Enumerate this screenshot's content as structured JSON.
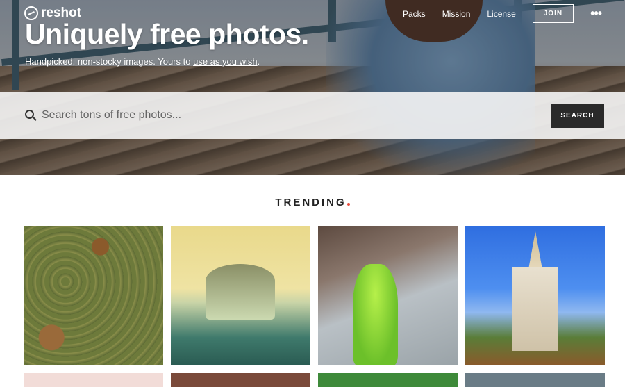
{
  "header": {
    "logo_text": "reshot",
    "nav": {
      "packs": "Packs",
      "mission": "Mission",
      "license": "License",
      "join": "JOIN",
      "more": "•••"
    }
  },
  "hero": {
    "headline": "Uniquely free photos.",
    "subline_prefix": "Handpicked, non-stocky images. Yours to ",
    "subline_link": "use as you wish",
    "subline_suffix": "."
  },
  "search": {
    "placeholder": "Search tons of free photos...",
    "value": "",
    "button": "SEARCH"
  },
  "trending": {
    "title": "TRENDING",
    "accent": "#e94b3c"
  },
  "gallery": {
    "items": [
      {
        "icon": "tigers-in-grass-photo"
      },
      {
        "icon": "domed-building-photo"
      },
      {
        "icon": "green-raincoat-rainy-window-photo"
      },
      {
        "icon": "temple-spire-photo"
      }
    ]
  },
  "colors": {
    "search_button": "#2a2a2a",
    "accent": "#e94b3c"
  }
}
